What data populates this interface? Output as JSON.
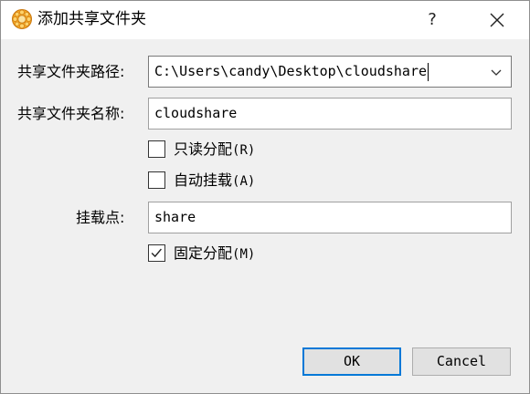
{
  "window": {
    "title": "添加共享文件夹",
    "help_label": "?",
    "close_icon": "close-icon",
    "app_icon": "virtualbox-gear-icon"
  },
  "form": {
    "path_label": "共享文件夹路径:",
    "path_value": "C:\\Users\\candy\\Desktop\\cloudshare",
    "name_label": "共享文件夹名称:",
    "name_value": "cloudshare",
    "readonly": {
      "label": "只读分配",
      "shortcut": "(R)",
      "checked": false
    },
    "automount": {
      "label": "自动挂载",
      "shortcut": "(A)",
      "checked": false
    },
    "mountpoint_label": "挂载点:",
    "mountpoint_value": "share",
    "permanent": {
      "label": "固定分配",
      "shortcut": "(M)",
      "checked": true
    }
  },
  "buttons": {
    "ok_label": "OK",
    "cancel_label": "Cancel"
  },
  "colors": {
    "accent": "#0078d7",
    "background": "#f0f0f0",
    "titlebar": "#ffffff"
  }
}
